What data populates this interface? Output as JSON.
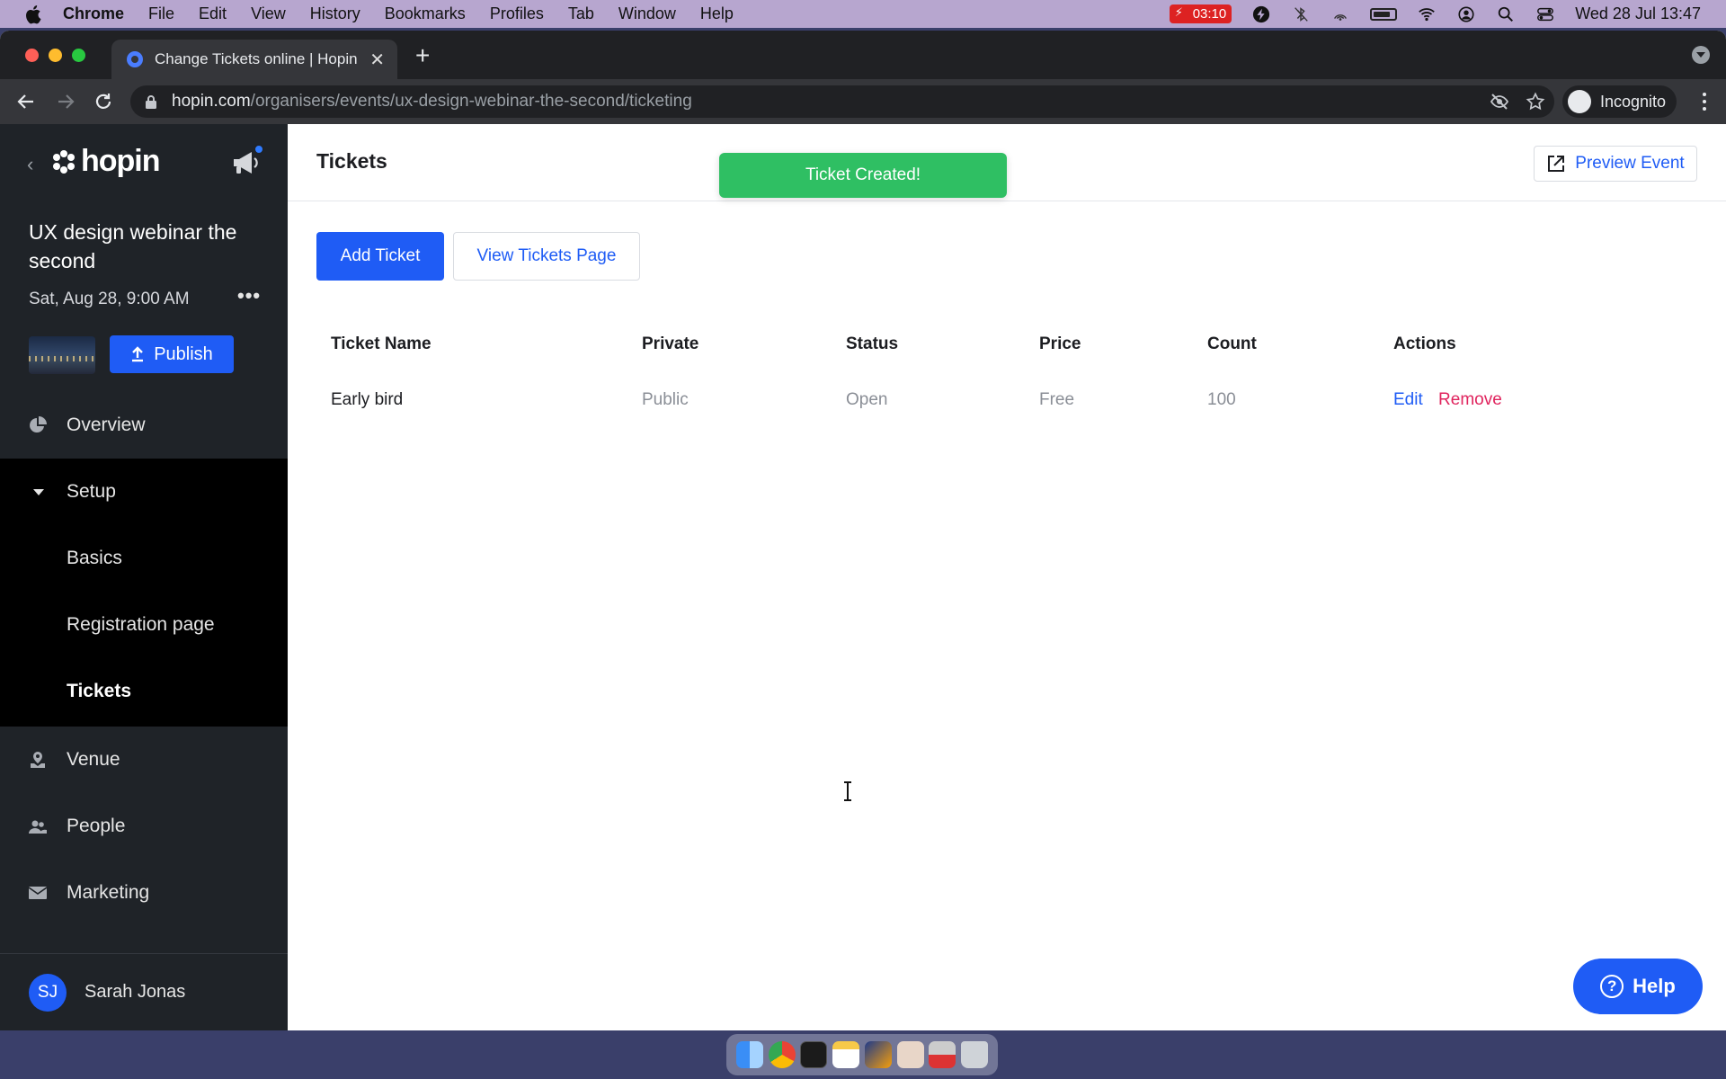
{
  "menubar": {
    "app": "Chrome",
    "items": [
      "File",
      "Edit",
      "View",
      "History",
      "Bookmarks",
      "Profiles",
      "Tab",
      "Window",
      "Help"
    ],
    "recording_time": "03:10",
    "datetime": "Wed 28 Jul  13:47"
  },
  "browser": {
    "tab_title": "Change Tickets online | Hopin",
    "url_host": "hopin.com",
    "url_path": "/organisers/events/ux-design-webinar-the-second/ticketing",
    "profile_label": "Incognito"
  },
  "sidebar": {
    "logo": "hopin",
    "event_title": "UX design webinar the second",
    "event_date": "Sat, Aug 28, 9:00 AM",
    "more": "•••",
    "publish_label": "Publish",
    "nav": {
      "overview": "Overview",
      "setup": "Setup",
      "basics": "Basics",
      "registration": "Registration page",
      "tickets": "Tickets",
      "venue": "Venue",
      "people": "People",
      "marketing": "Marketing"
    },
    "user": {
      "initials": "SJ",
      "name": "Sarah Jonas"
    }
  },
  "main": {
    "title": "Tickets",
    "toast": "Ticket Created!",
    "preview_label": "Preview Event",
    "add_ticket_label": "Add Ticket",
    "view_tickets_label": "View Tickets Page",
    "table": {
      "headers": [
        "Ticket Name",
        "Private",
        "Status",
        "Price",
        "Count",
        "Actions"
      ],
      "rows": [
        {
          "name": "Early bird",
          "private": "Public",
          "status": "Open",
          "price": "Free",
          "count": "100",
          "edit": "Edit",
          "remove": "Remove"
        }
      ]
    },
    "help_label": "Help"
  },
  "colors": {
    "accent": "#1f5cf5",
    "success": "#2fbf63",
    "danger": "#e0245e",
    "sidebar_bg": "#1f2328"
  }
}
